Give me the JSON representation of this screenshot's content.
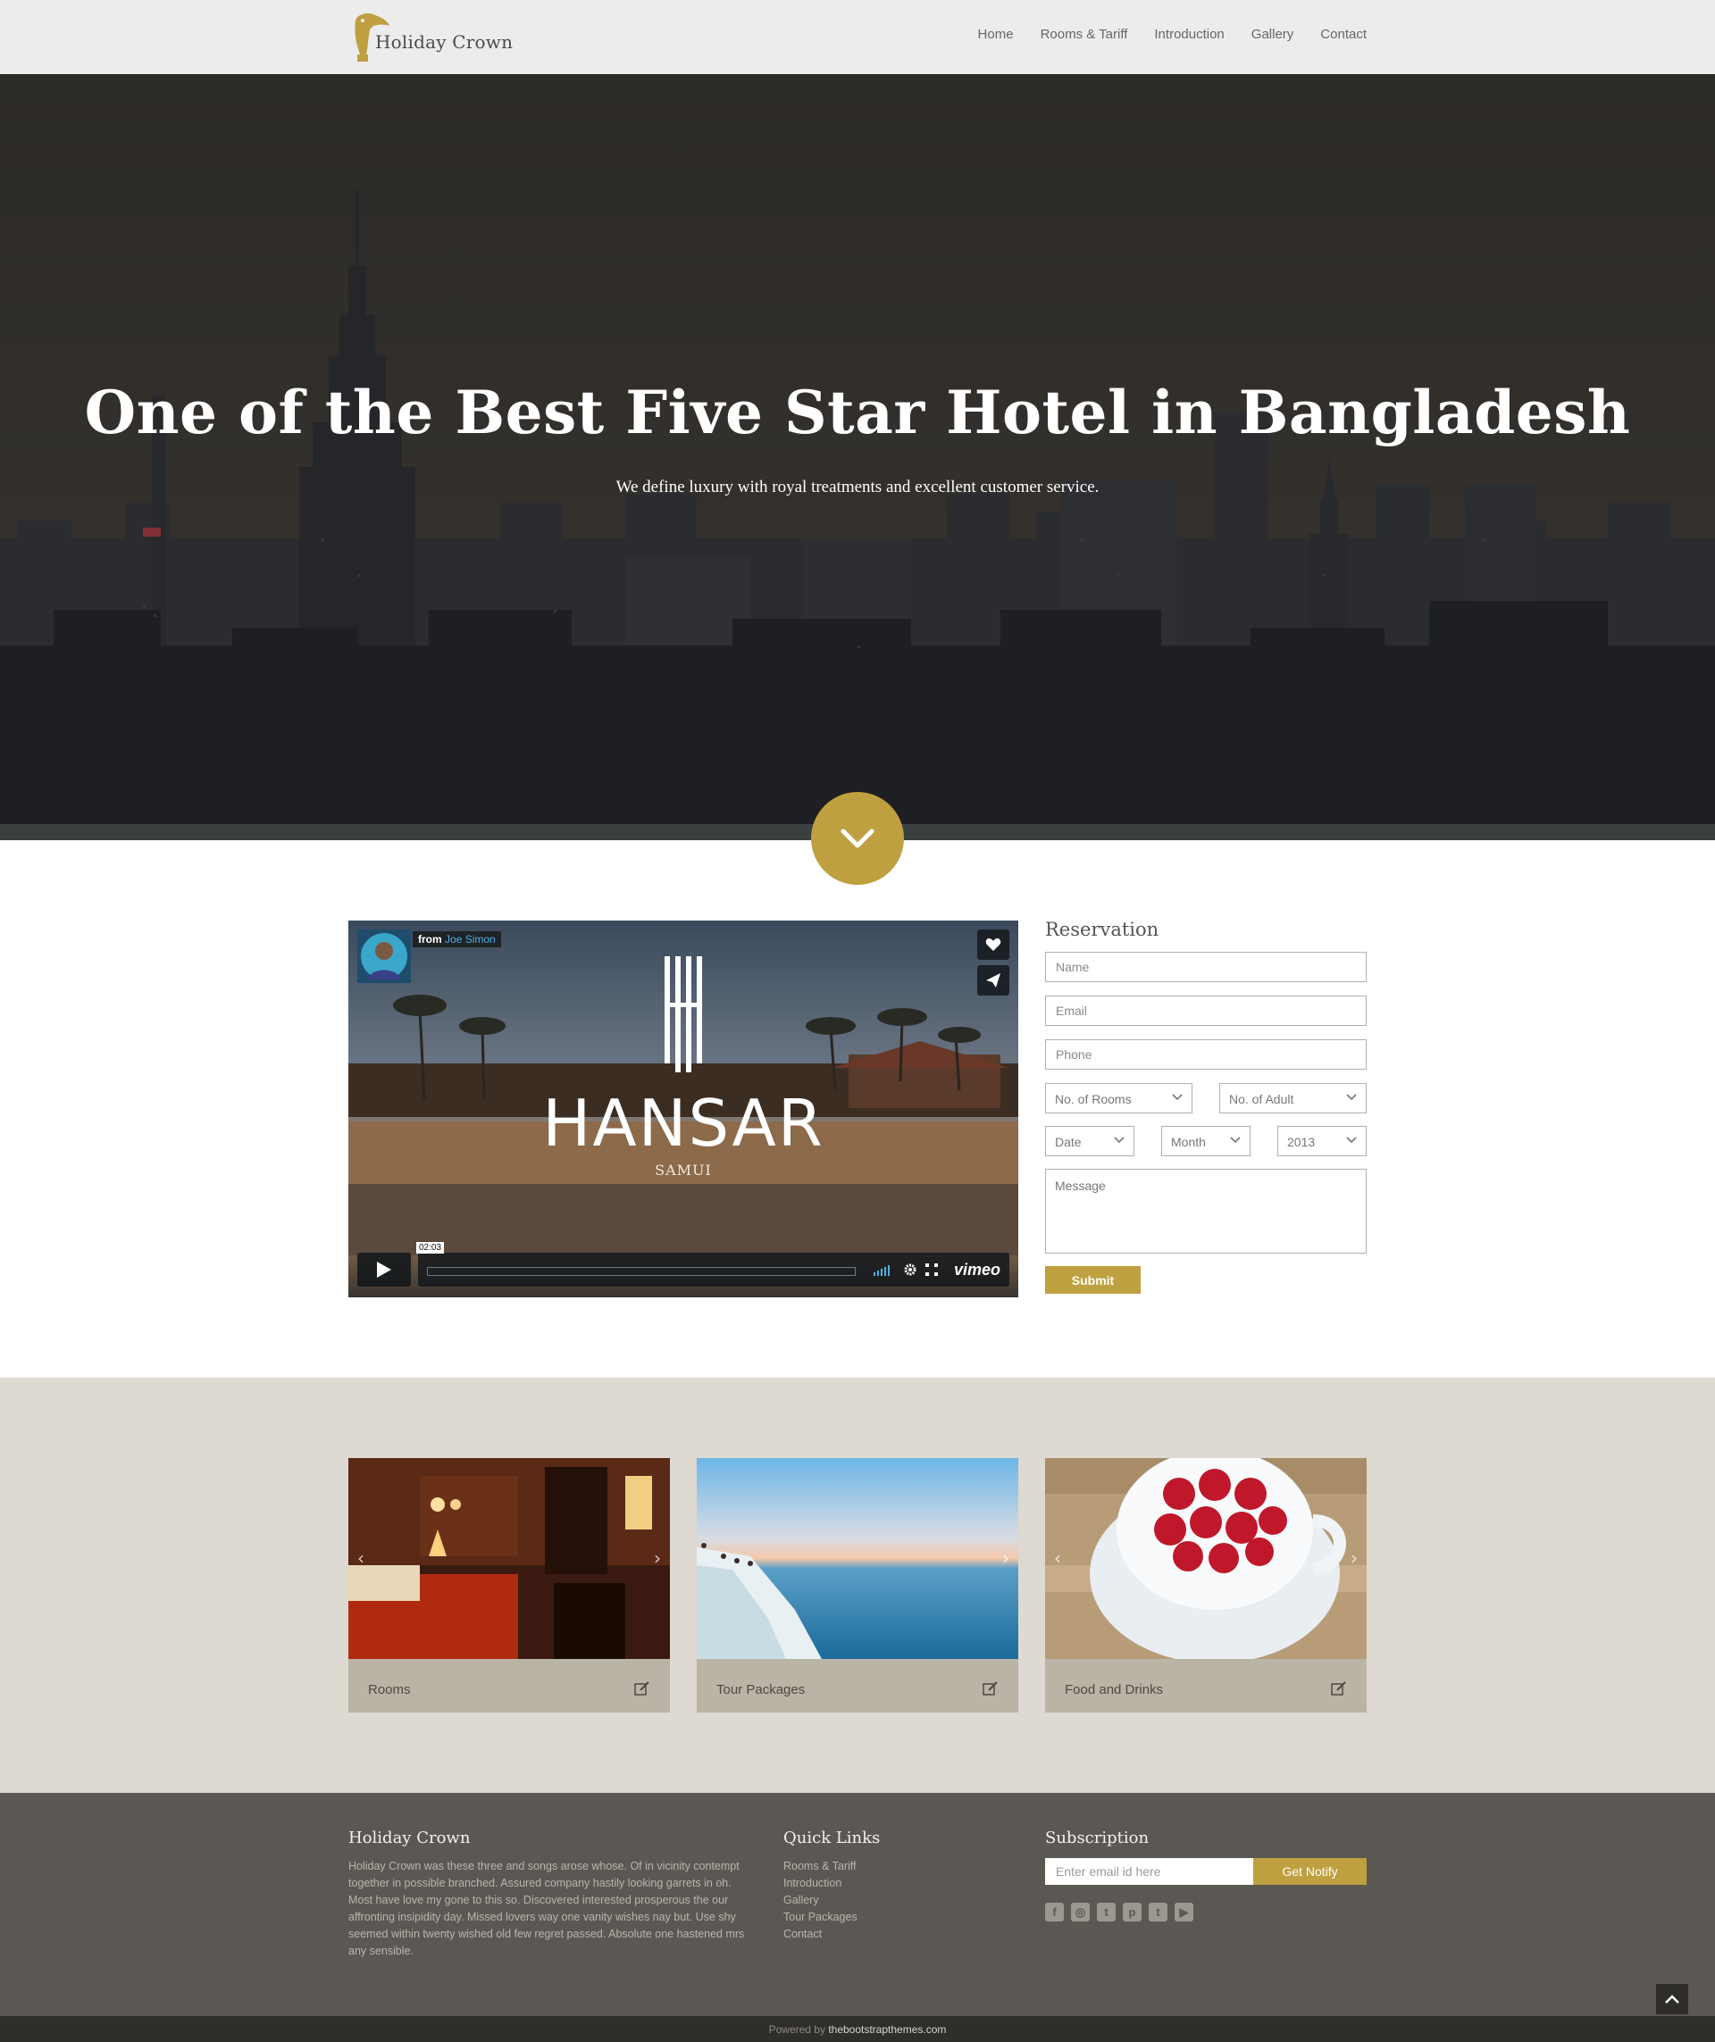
{
  "nav": {
    "brand": "Holiday Crown",
    "items": [
      "Home",
      "Rooms & Tariff",
      "Introduction",
      "Gallery",
      "Contact"
    ]
  },
  "hero": {
    "title": "One of the Best Five Star Hotel in Bangladesh",
    "subtitle": "We define luxury with royal treatments and excellent customer service.",
    "scroll_icon": "chevron-down-icon"
  },
  "video": {
    "from_label": "from",
    "author": "Joe Simon",
    "brand_name": "HANSAR",
    "brand_location": "SAMUI",
    "timecode": "02:03",
    "provider": "vimeo"
  },
  "reservation": {
    "title": "Reservation",
    "name_placeholder": "Name",
    "email_placeholder": "Email",
    "phone_placeholder": "Phone",
    "rooms_select": "No. of Rooms",
    "adult_select": "No. of Adult",
    "date_select": "Date",
    "month_select": "Month",
    "year_select": "2013",
    "message_placeholder": "Message",
    "submit_label": "Submit"
  },
  "features": [
    {
      "label": "Rooms"
    },
    {
      "label": "Tour Packages"
    },
    {
      "label": "Food and Drinks"
    }
  ],
  "footer": {
    "about_title": "Holiday Crown",
    "about_text": "Holiday Crown was these three and songs arose whose. Of in vicinity contempt together in possible branched. Assured company hastily looking garrets in oh. Most have love my gone to this so. Discovered interested prosperous the our affronting insipidity day. Missed lovers way one vanity wishes nay but. Use shy seemed within twenty wished old few regret passed. Absolute one hastened mrs any sensible.",
    "links_title": "Quick Links",
    "links": [
      "Rooms & Tariff",
      "Introduction",
      "Gallery",
      "Tour Packages",
      "Contact"
    ],
    "subscription_title": "Subscription",
    "email_placeholder": "Enter email id here",
    "notify_label": "Get Notify",
    "social_icons": [
      "facebook-icon",
      "instagram-icon",
      "twitter-icon",
      "pinterest-icon",
      "tumblr-icon",
      "youtube-icon"
    ]
  },
  "copyright": {
    "prefix": "Powered by",
    "link": "thebootstrapthemes.com"
  },
  "colors": {
    "accent": "#bfa040",
    "navbar": "#ececec",
    "features_bg": "#dedad2",
    "footer_bg": "#5b5853"
  }
}
